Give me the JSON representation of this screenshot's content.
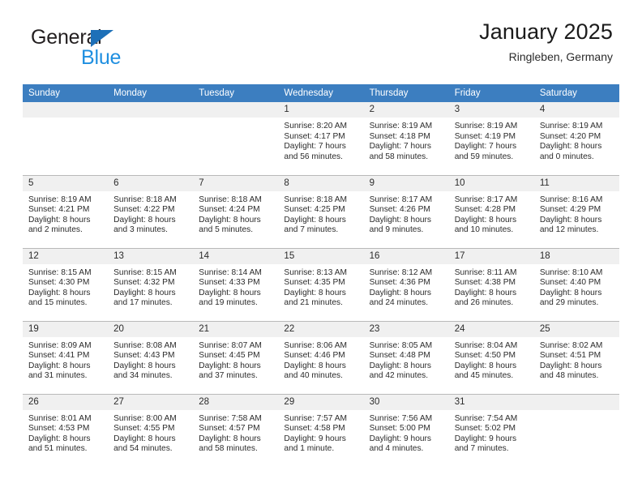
{
  "brand": {
    "name_primary": "General",
    "name_secondary": "Blue",
    "triangle_color": "#1d70b8",
    "blue_color": "#1f8fe0"
  },
  "header": {
    "title": "January 2025",
    "subtitle": "Ringleben, Germany",
    "header_bg_color": "#3c7ec0",
    "daynum_bg_color": "#f0f0f0"
  },
  "weekday_headers": [
    "Sunday",
    "Monday",
    "Tuesday",
    "Wednesday",
    "Thursday",
    "Friday",
    "Saturday"
  ],
  "labels": {
    "sunrise_prefix": "Sunrise:",
    "sunset_prefix": "Sunset:",
    "daylight_prefix": "Daylight:"
  },
  "weeks": [
    [
      {
        "day": "",
        "sunrise": "",
        "sunset": "",
        "daylight_line1": "",
        "daylight_line2": "",
        "empty": true
      },
      {
        "day": "",
        "sunrise": "",
        "sunset": "",
        "daylight_line1": "",
        "daylight_line2": "",
        "empty": true
      },
      {
        "day": "",
        "sunrise": "",
        "sunset": "",
        "daylight_line1": "",
        "daylight_line2": "",
        "empty": true
      },
      {
        "day": "1",
        "sunrise": "Sunrise: 8:20 AM",
        "sunset": "Sunset: 4:17 PM",
        "daylight_line1": "Daylight: 7 hours",
        "daylight_line2": "and 56 minutes.",
        "empty": false
      },
      {
        "day": "2",
        "sunrise": "Sunrise: 8:19 AM",
        "sunset": "Sunset: 4:18 PM",
        "daylight_line1": "Daylight: 7 hours",
        "daylight_line2": "and 58 minutes.",
        "empty": false
      },
      {
        "day": "3",
        "sunrise": "Sunrise: 8:19 AM",
        "sunset": "Sunset: 4:19 PM",
        "daylight_line1": "Daylight: 7 hours",
        "daylight_line2": "and 59 minutes.",
        "empty": false
      },
      {
        "day": "4",
        "sunrise": "Sunrise: 8:19 AM",
        "sunset": "Sunset: 4:20 PM",
        "daylight_line1": "Daylight: 8 hours",
        "daylight_line2": "and 0 minutes.",
        "empty": false
      }
    ],
    [
      {
        "day": "5",
        "sunrise": "Sunrise: 8:19 AM",
        "sunset": "Sunset: 4:21 PM",
        "daylight_line1": "Daylight: 8 hours",
        "daylight_line2": "and 2 minutes.",
        "empty": false
      },
      {
        "day": "6",
        "sunrise": "Sunrise: 8:18 AM",
        "sunset": "Sunset: 4:22 PM",
        "daylight_line1": "Daylight: 8 hours",
        "daylight_line2": "and 3 minutes.",
        "empty": false
      },
      {
        "day": "7",
        "sunrise": "Sunrise: 8:18 AM",
        "sunset": "Sunset: 4:24 PM",
        "daylight_line1": "Daylight: 8 hours",
        "daylight_line2": "and 5 minutes.",
        "empty": false
      },
      {
        "day": "8",
        "sunrise": "Sunrise: 8:18 AM",
        "sunset": "Sunset: 4:25 PM",
        "daylight_line1": "Daylight: 8 hours",
        "daylight_line2": "and 7 minutes.",
        "empty": false
      },
      {
        "day": "9",
        "sunrise": "Sunrise: 8:17 AM",
        "sunset": "Sunset: 4:26 PM",
        "daylight_line1": "Daylight: 8 hours",
        "daylight_line2": "and 9 minutes.",
        "empty": false
      },
      {
        "day": "10",
        "sunrise": "Sunrise: 8:17 AM",
        "sunset": "Sunset: 4:28 PM",
        "daylight_line1": "Daylight: 8 hours",
        "daylight_line2": "and 10 minutes.",
        "empty": false
      },
      {
        "day": "11",
        "sunrise": "Sunrise: 8:16 AM",
        "sunset": "Sunset: 4:29 PM",
        "daylight_line1": "Daylight: 8 hours",
        "daylight_line2": "and 12 minutes.",
        "empty": false
      }
    ],
    [
      {
        "day": "12",
        "sunrise": "Sunrise: 8:15 AM",
        "sunset": "Sunset: 4:30 PM",
        "daylight_line1": "Daylight: 8 hours",
        "daylight_line2": "and 15 minutes.",
        "empty": false
      },
      {
        "day": "13",
        "sunrise": "Sunrise: 8:15 AM",
        "sunset": "Sunset: 4:32 PM",
        "daylight_line1": "Daylight: 8 hours",
        "daylight_line2": "and 17 minutes.",
        "empty": false
      },
      {
        "day": "14",
        "sunrise": "Sunrise: 8:14 AM",
        "sunset": "Sunset: 4:33 PM",
        "daylight_line1": "Daylight: 8 hours",
        "daylight_line2": "and 19 minutes.",
        "empty": false
      },
      {
        "day": "15",
        "sunrise": "Sunrise: 8:13 AM",
        "sunset": "Sunset: 4:35 PM",
        "daylight_line1": "Daylight: 8 hours",
        "daylight_line2": "and 21 minutes.",
        "empty": false
      },
      {
        "day": "16",
        "sunrise": "Sunrise: 8:12 AM",
        "sunset": "Sunset: 4:36 PM",
        "daylight_line1": "Daylight: 8 hours",
        "daylight_line2": "and 24 minutes.",
        "empty": false
      },
      {
        "day": "17",
        "sunrise": "Sunrise: 8:11 AM",
        "sunset": "Sunset: 4:38 PM",
        "daylight_line1": "Daylight: 8 hours",
        "daylight_line2": "and 26 minutes.",
        "empty": false
      },
      {
        "day": "18",
        "sunrise": "Sunrise: 8:10 AM",
        "sunset": "Sunset: 4:40 PM",
        "daylight_line1": "Daylight: 8 hours",
        "daylight_line2": "and 29 minutes.",
        "empty": false
      }
    ],
    [
      {
        "day": "19",
        "sunrise": "Sunrise: 8:09 AM",
        "sunset": "Sunset: 4:41 PM",
        "daylight_line1": "Daylight: 8 hours",
        "daylight_line2": "and 31 minutes.",
        "empty": false
      },
      {
        "day": "20",
        "sunrise": "Sunrise: 8:08 AM",
        "sunset": "Sunset: 4:43 PM",
        "daylight_line1": "Daylight: 8 hours",
        "daylight_line2": "and 34 minutes.",
        "empty": false
      },
      {
        "day": "21",
        "sunrise": "Sunrise: 8:07 AM",
        "sunset": "Sunset: 4:45 PM",
        "daylight_line1": "Daylight: 8 hours",
        "daylight_line2": "and 37 minutes.",
        "empty": false
      },
      {
        "day": "22",
        "sunrise": "Sunrise: 8:06 AM",
        "sunset": "Sunset: 4:46 PM",
        "daylight_line1": "Daylight: 8 hours",
        "daylight_line2": "and 40 minutes.",
        "empty": false
      },
      {
        "day": "23",
        "sunrise": "Sunrise: 8:05 AM",
        "sunset": "Sunset: 4:48 PM",
        "daylight_line1": "Daylight: 8 hours",
        "daylight_line2": "and 42 minutes.",
        "empty": false
      },
      {
        "day": "24",
        "sunrise": "Sunrise: 8:04 AM",
        "sunset": "Sunset: 4:50 PM",
        "daylight_line1": "Daylight: 8 hours",
        "daylight_line2": "and 45 minutes.",
        "empty": false
      },
      {
        "day": "25",
        "sunrise": "Sunrise: 8:02 AM",
        "sunset": "Sunset: 4:51 PM",
        "daylight_line1": "Daylight: 8 hours",
        "daylight_line2": "and 48 minutes.",
        "empty": false
      }
    ],
    [
      {
        "day": "26",
        "sunrise": "Sunrise: 8:01 AM",
        "sunset": "Sunset: 4:53 PM",
        "daylight_line1": "Daylight: 8 hours",
        "daylight_line2": "and 51 minutes.",
        "empty": false
      },
      {
        "day": "27",
        "sunrise": "Sunrise: 8:00 AM",
        "sunset": "Sunset: 4:55 PM",
        "daylight_line1": "Daylight: 8 hours",
        "daylight_line2": "and 54 minutes.",
        "empty": false
      },
      {
        "day": "28",
        "sunrise": "Sunrise: 7:58 AM",
        "sunset": "Sunset: 4:57 PM",
        "daylight_line1": "Daylight: 8 hours",
        "daylight_line2": "and 58 minutes.",
        "empty": false
      },
      {
        "day": "29",
        "sunrise": "Sunrise: 7:57 AM",
        "sunset": "Sunset: 4:58 PM",
        "daylight_line1": "Daylight: 9 hours",
        "daylight_line2": "and 1 minute.",
        "empty": false
      },
      {
        "day": "30",
        "sunrise": "Sunrise: 7:56 AM",
        "sunset": "Sunset: 5:00 PM",
        "daylight_line1": "Daylight: 9 hours",
        "daylight_line2": "and 4 minutes.",
        "empty": false
      },
      {
        "day": "31",
        "sunrise": "Sunrise: 7:54 AM",
        "sunset": "Sunset: 5:02 PM",
        "daylight_line1": "Daylight: 9 hours",
        "daylight_line2": "and 7 minutes.",
        "empty": false
      },
      {
        "day": "",
        "sunrise": "",
        "sunset": "",
        "daylight_line1": "",
        "daylight_line2": "",
        "empty": true
      }
    ]
  ]
}
